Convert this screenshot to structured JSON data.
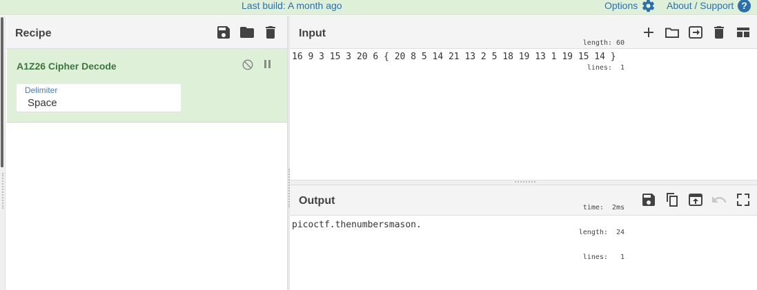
{
  "banner": {
    "last_build": "Last build: A month ago",
    "options_label": "Options",
    "about_label": "About / Support",
    "help_glyph": "?"
  },
  "recipe": {
    "title": "Recipe",
    "icons": [
      "save-icon",
      "open-folder-icon",
      "delete-icon"
    ],
    "operation": {
      "name": "A1Z26 Cipher Decode",
      "delimiter_label": "Delimiter",
      "delimiter_value": "Space"
    }
  },
  "input": {
    "title": "Input",
    "length_info": "length: 60",
    "lines_info": "lines:  1",
    "text": "16 9 3 15 3 20 6 { 20 8 5 14 21 13 2 5 18 19 13 1 19 15 14 }",
    "icons": [
      "add-tab-icon",
      "open-folder-icon",
      "open-file-icon",
      "delete-icon",
      "layout-icon"
    ]
  },
  "output": {
    "title": "Output",
    "time_info": "time:  2ms",
    "length_info": "length:  24",
    "lines_info": "lines:   1",
    "text": "picoctf.thenumbersmason.",
    "icons": [
      "save-icon",
      "copy-icon",
      "replace-input-icon",
      "undo-icon",
      "maximize-icon"
    ]
  },
  "colors": {
    "banner_bg": "#dff0d8",
    "link": "#2a6fb0",
    "operation_bg": "#dff0d8",
    "operation_text": "#3c763d",
    "field_label": "#3a7ec4"
  }
}
